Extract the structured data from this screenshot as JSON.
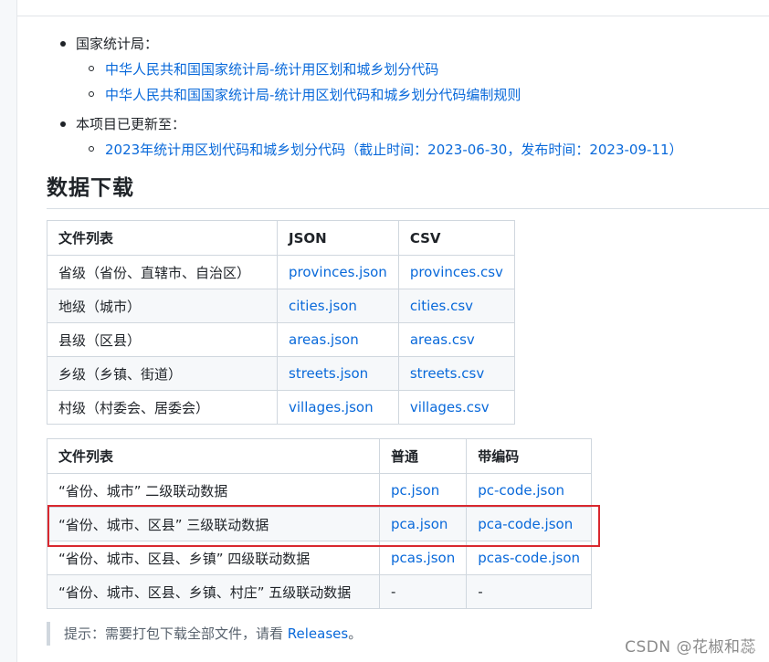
{
  "sources": {
    "bureau_label": "国家统计局：",
    "bureau_links": [
      "中华人民共和国国家统计局-统计用区划和城乡划分代码",
      "中华人民共和国国家统计局-统计用区划代码和城乡划分代码编制规则"
    ],
    "updated_label": "本项目已更新至：",
    "updated_link": "2023年统计用区划代码和城乡划分代码（截止时间：2023-06-30，发布时间：2023-09-11）"
  },
  "section_title": "数据下载",
  "download_table": {
    "headers": [
      "文件列表",
      "JSON",
      "CSV"
    ],
    "rows": [
      {
        "name": "省级（省份、直辖市、自治区）",
        "json": "provinces.json",
        "csv": "provinces.csv"
      },
      {
        "name": "地级（城市）",
        "json": "cities.json",
        "csv": "cities.csv"
      },
      {
        "name": "县级（区县）",
        "json": "areas.json",
        "csv": "areas.csv"
      },
      {
        "name": "乡级（乡镇、街道）",
        "json": "streets.json",
        "csv": "streets.csv"
      },
      {
        "name": "村级（村委会、居委会）",
        "json": "villages.json",
        "csv": "villages.csv"
      }
    ]
  },
  "linkage_table": {
    "headers": [
      "文件列表",
      "普通",
      "带编码"
    ],
    "rows": [
      {
        "name": "“省份、城市” 二级联动数据",
        "plain": "pc.json",
        "coded": "pc-code.json"
      },
      {
        "name": "“省份、城市、区县” 三级联动数据",
        "plain": "pca.json",
        "coded": "pca-code.json"
      },
      {
        "name": "“省份、城市、区县、乡镇” 四级联动数据",
        "plain": "pcas.json",
        "coded": "pcas-code.json"
      },
      {
        "name": "“省份、城市、区县、乡镇、村庄” 五级联动数据",
        "plain": "-",
        "coded": "-"
      }
    ]
  },
  "tip": {
    "prefix": "提示：需要打包下载全部文件，请看 ",
    "link": "Releases",
    "suffix": "。"
  },
  "watermark": "CSDN @花椒和蕊",
  "colors": {
    "link": "#0969da",
    "highlight": "#d9282f",
    "text": "#1f2328"
  }
}
